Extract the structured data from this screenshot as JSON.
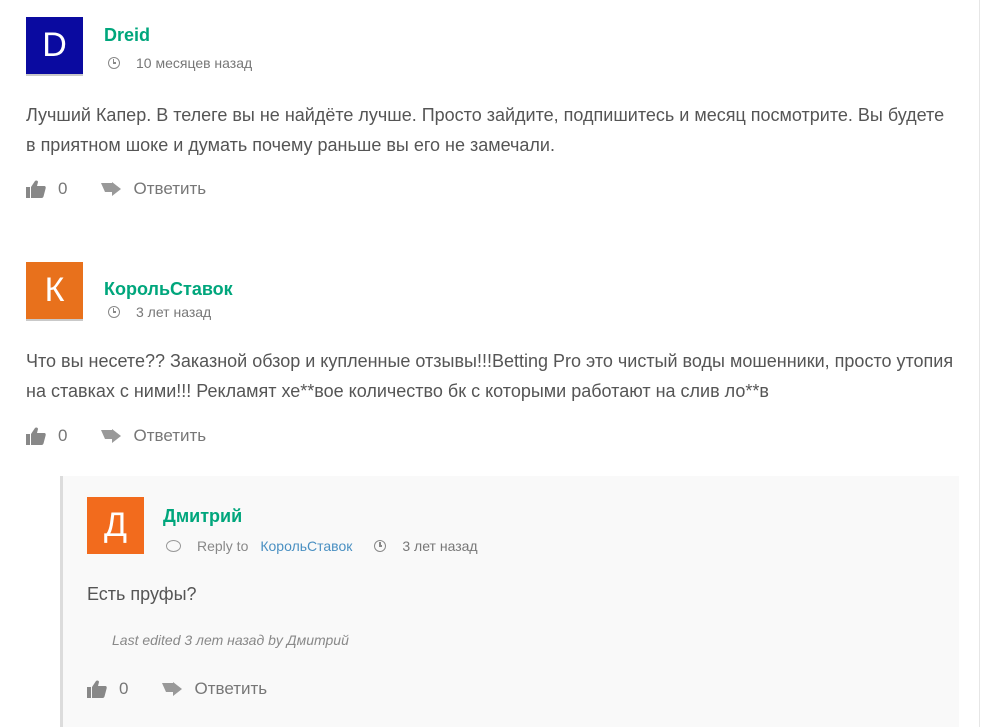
{
  "comments": [
    {
      "avatar_letter": "D",
      "avatar_color": "#0a0aa0",
      "author": "Dreid",
      "time": "10 месяцев назад",
      "text": "Лучший Капер. В телеге вы не найдёте лучше. Просто зайдите, подпишитесь и месяц посмотрите. Вы будете в приятном шоке и думать почему раньше вы его не замечали.",
      "likes": "0",
      "reply_label": "Ответить"
    },
    {
      "avatar_letter": "К",
      "avatar_color": "#e8711c",
      "author": "КорольСтавок",
      "time": "3 лет назад",
      "text": "Что вы несете?? Заказной обзор и купленные отзывы!!!Betting Pro это чистый воды мошенники, просто утопия на ставках с ними!!! Рекламят хе**вое количество бк с которыми работают на слив ло**в",
      "likes": "0",
      "reply_label": "Ответить"
    }
  ],
  "reply": {
    "avatar_letter": "Д",
    "avatar_color": "#f26b1d",
    "author": "Дмитрий",
    "reply_to_label": "Reply to",
    "reply_to_name": "КорольСтавок",
    "time": "3 лет назад",
    "text": "Есть пруфы?",
    "edited": "Last edited 3 лет назад by Дмитрий",
    "likes": "0",
    "reply_label": "Ответить"
  }
}
